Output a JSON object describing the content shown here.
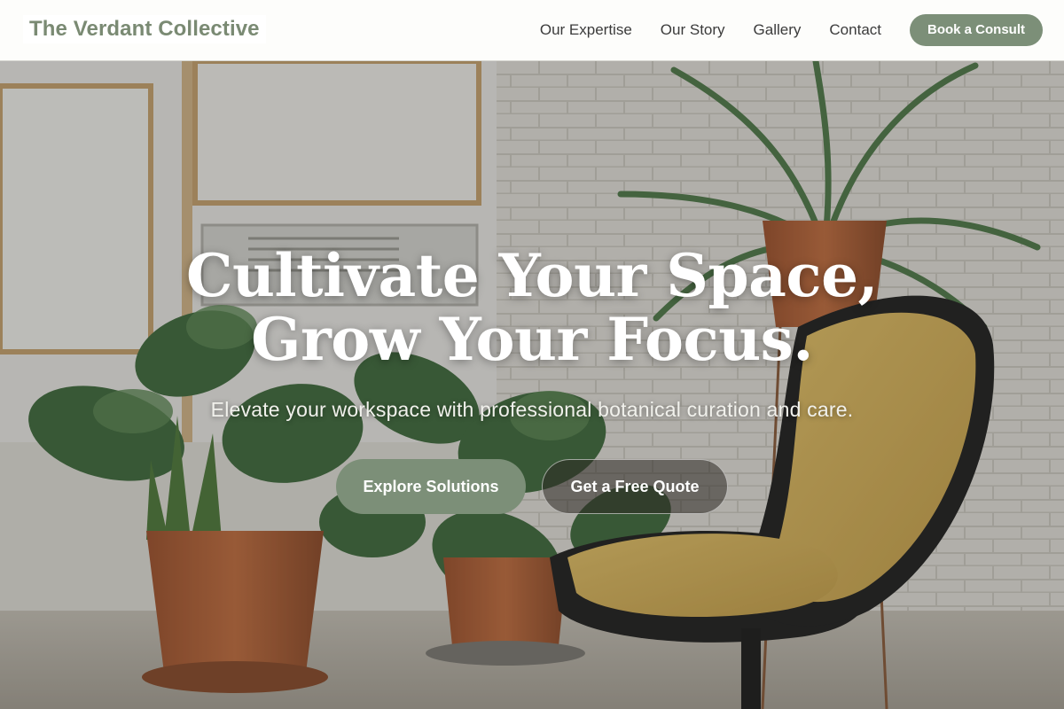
{
  "brand": {
    "name": "The Verdant Collective"
  },
  "nav": {
    "links": [
      {
        "label": "Our Expertise"
      },
      {
        "label": "Our Story"
      },
      {
        "label": "Gallery"
      },
      {
        "label": "Contact"
      }
    ],
    "cta_label": "Book a Consult"
  },
  "hero": {
    "title_line1": "Cultivate Your Space,",
    "title_line2": "Grow Your Focus.",
    "subtitle": "Elevate your workspace with professional botanical curation and care.",
    "primary_button": "Explore Solutions",
    "secondary_button": "Get a Free Quote",
    "background_image": "office-plants-and-chair-photo"
  },
  "colors": {
    "accent": "#7c8f78",
    "brand_text": "#7a8a73",
    "nav_text": "#3b3b3b",
    "hero_text": "#ffffff"
  }
}
